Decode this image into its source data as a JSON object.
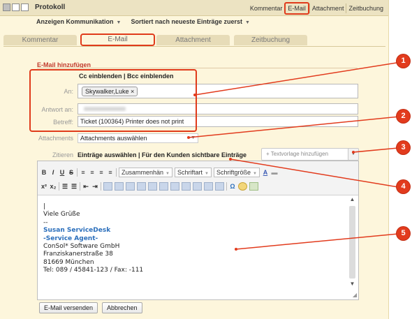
{
  "titlebar": {
    "title": "Protokoll",
    "links": [
      "Kommentar",
      "E-Mail",
      "Attachment",
      "Zeitbuchung"
    ]
  },
  "menubar": {
    "anzeigen": "Anzeigen Kommunikation",
    "sort": "Sortiert nach neueste Einträge zuerst"
  },
  "tabs": [
    "Kommentar",
    "E-Mail",
    "Attachment",
    "Zeitbuchung"
  ],
  "form": {
    "section_title": "E-Mail hinzufügen",
    "cc_bcc": "Cc einblenden | Bcc einblenden",
    "an_label": "An:",
    "an_token": "Skywalker,Luke ×",
    "antwort_label": "Antwort an:",
    "betreff_label": "Betreff:",
    "betreff_value": "Ticket (100364) Printer does not print",
    "attachments_label": "Attachments",
    "attachments_value": "Attachments auswählen",
    "zitieren_label": "Zitieren",
    "zitieren_value": "Einträge auswählen | Für den Kunden sichtbare Einträge",
    "textvorlage": "+ Textvorlage hinzufügen",
    "required_mark": "*"
  },
  "editor": {
    "format_label": "Zusammenhän",
    "font_label": "Schriftart",
    "size_label": "Schriftgröße",
    "lines": [
      "Viele Grüße",
      "--",
      "Susan ServiceDesk",
      "-Service Agent-",
      "ConSol* Software GmbH",
      "Franziskanerstraße 38",
      "81669 München",
      "Tel: 089 / 45841-123 / Fax: -111"
    ]
  },
  "buttons": {
    "send": "E-Mail versenden",
    "cancel": "Abbrechen"
  },
  "callouts": [
    "1",
    "2",
    "3",
    "4",
    "5"
  ],
  "colors": {
    "highlight": "#e03b1b",
    "panel": "#fdf6dc",
    "section_title": "#c0392b",
    "signature_blue": "#2a6ebb"
  }
}
